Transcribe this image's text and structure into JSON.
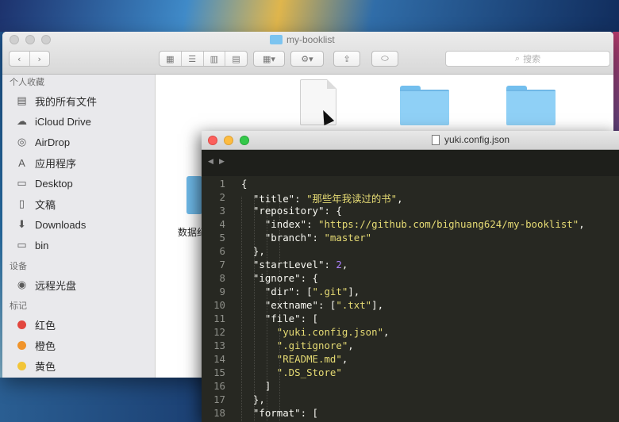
{
  "finder": {
    "title": "my-booklist",
    "search_placeholder": "搜索",
    "sidebar": {
      "favorites_header": "个人收藏",
      "favorites": [
        {
          "label": "我的所有文件",
          "icon": "all-files-icon"
        },
        {
          "label": "iCloud Drive",
          "icon": "cloud-icon"
        },
        {
          "label": "AirDrop",
          "icon": "airdrop-icon"
        },
        {
          "label": "应用程序",
          "icon": "applications-icon"
        },
        {
          "label": "Desktop",
          "icon": "desktop-icon"
        },
        {
          "label": "文稿",
          "icon": "documents-icon"
        },
        {
          "label": "Downloads",
          "icon": "downloads-icon"
        },
        {
          "label": "bin",
          "icon": "folder-icon"
        }
      ],
      "devices_header": "设备",
      "devices": [
        {
          "label": "远程光盘",
          "icon": "disc-icon"
        }
      ],
      "tags_header": "标记",
      "tags": [
        {
          "label": "红色",
          "color": "#e2463e"
        },
        {
          "label": "橙色",
          "color": "#f0942b"
        },
        {
          "label": "黄色",
          "color": "#f2c538"
        }
      ]
    },
    "content": {
      "partial_label": "数据纪"
    }
  },
  "editor": {
    "filename": "yuki.config.json",
    "lines": [
      {
        "n": "1",
        "tokens": [
          [
            "p",
            "{"
          ]
        ]
      },
      {
        "n": "2",
        "tokens": [
          [
            "p",
            "  "
          ],
          [
            "k",
            "\"title\""
          ],
          [
            "p",
            ": "
          ],
          [
            "s",
            "\"那些年我读过的书\""
          ],
          [
            "p",
            ","
          ]
        ]
      },
      {
        "n": "3",
        "tokens": [
          [
            "p",
            "  "
          ],
          [
            "k",
            "\"repository\""
          ],
          [
            "p",
            ": {"
          ]
        ]
      },
      {
        "n": "4",
        "tokens": [
          [
            "p",
            "    "
          ],
          [
            "k",
            "\"index\""
          ],
          [
            "p",
            ": "
          ],
          [
            "s",
            "\"https://github.com/bighuang624/my-booklist\""
          ],
          [
            "p",
            ","
          ]
        ]
      },
      {
        "n": "5",
        "tokens": [
          [
            "p",
            "    "
          ],
          [
            "k",
            "\"branch\""
          ],
          [
            "p",
            ": "
          ],
          [
            "s",
            "\"master\""
          ]
        ]
      },
      {
        "n": "6",
        "tokens": [
          [
            "p",
            "  },"
          ]
        ]
      },
      {
        "n": "7",
        "tokens": [
          [
            "p",
            "  "
          ],
          [
            "k",
            "\"startLevel\""
          ],
          [
            "p",
            ": "
          ],
          [
            "n",
            "2"
          ],
          [
            "p",
            ","
          ]
        ]
      },
      {
        "n": "8",
        "tokens": [
          [
            "p",
            "  "
          ],
          [
            "k",
            "\"ignore\""
          ],
          [
            "p",
            ": {"
          ]
        ]
      },
      {
        "n": "9",
        "tokens": [
          [
            "p",
            "    "
          ],
          [
            "k",
            "\"dir\""
          ],
          [
            "p",
            ": ["
          ],
          [
            "s",
            "\".git\""
          ],
          [
            "p",
            "],"
          ]
        ]
      },
      {
        "n": "10",
        "tokens": [
          [
            "p",
            "    "
          ],
          [
            "k",
            "\"extname\""
          ],
          [
            "p",
            ": ["
          ],
          [
            "s",
            "\".txt\""
          ],
          [
            "p",
            "],"
          ]
        ]
      },
      {
        "n": "11",
        "tokens": [
          [
            "p",
            "    "
          ],
          [
            "k",
            "\"file\""
          ],
          [
            "p",
            ": ["
          ]
        ]
      },
      {
        "n": "12",
        "tokens": [
          [
            "p",
            "      "
          ],
          [
            "s",
            "\"yuki.config.json\""
          ],
          [
            "p",
            ","
          ]
        ]
      },
      {
        "n": "13",
        "tokens": [
          [
            "p",
            "      "
          ],
          [
            "s",
            "\".gitignore\""
          ],
          [
            "p",
            ","
          ]
        ]
      },
      {
        "n": "14",
        "tokens": [
          [
            "p",
            "      "
          ],
          [
            "s",
            "\"README.md\""
          ],
          [
            "p",
            ","
          ]
        ]
      },
      {
        "n": "15",
        "tokens": [
          [
            "p",
            "      "
          ],
          [
            "s",
            "\".DS_Store\""
          ]
        ]
      },
      {
        "n": "16",
        "tokens": [
          [
            "p",
            "    ]"
          ]
        ]
      },
      {
        "n": "17",
        "tokens": [
          [
            "p",
            "  },"
          ]
        ]
      },
      {
        "n": "18",
        "tokens": [
          [
            "p",
            "  "
          ],
          [
            "k",
            "\"format\""
          ],
          [
            "p",
            ": ["
          ]
        ]
      }
    ]
  }
}
